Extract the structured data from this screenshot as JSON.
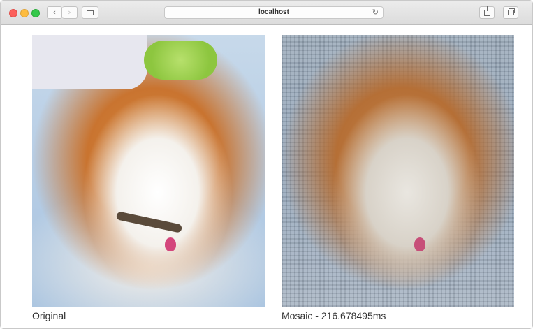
{
  "window": {
    "address": "localhost"
  },
  "captions": {
    "original": "Original",
    "mosaic": "Mosaic - 216.678495ms"
  },
  "icons": {
    "back": "chevron-left-icon",
    "forward": "chevron-right-icon",
    "sidebar": "sidebar-icon",
    "reload": "reload-icon",
    "share": "share-icon",
    "tabs": "tabs-icon"
  }
}
